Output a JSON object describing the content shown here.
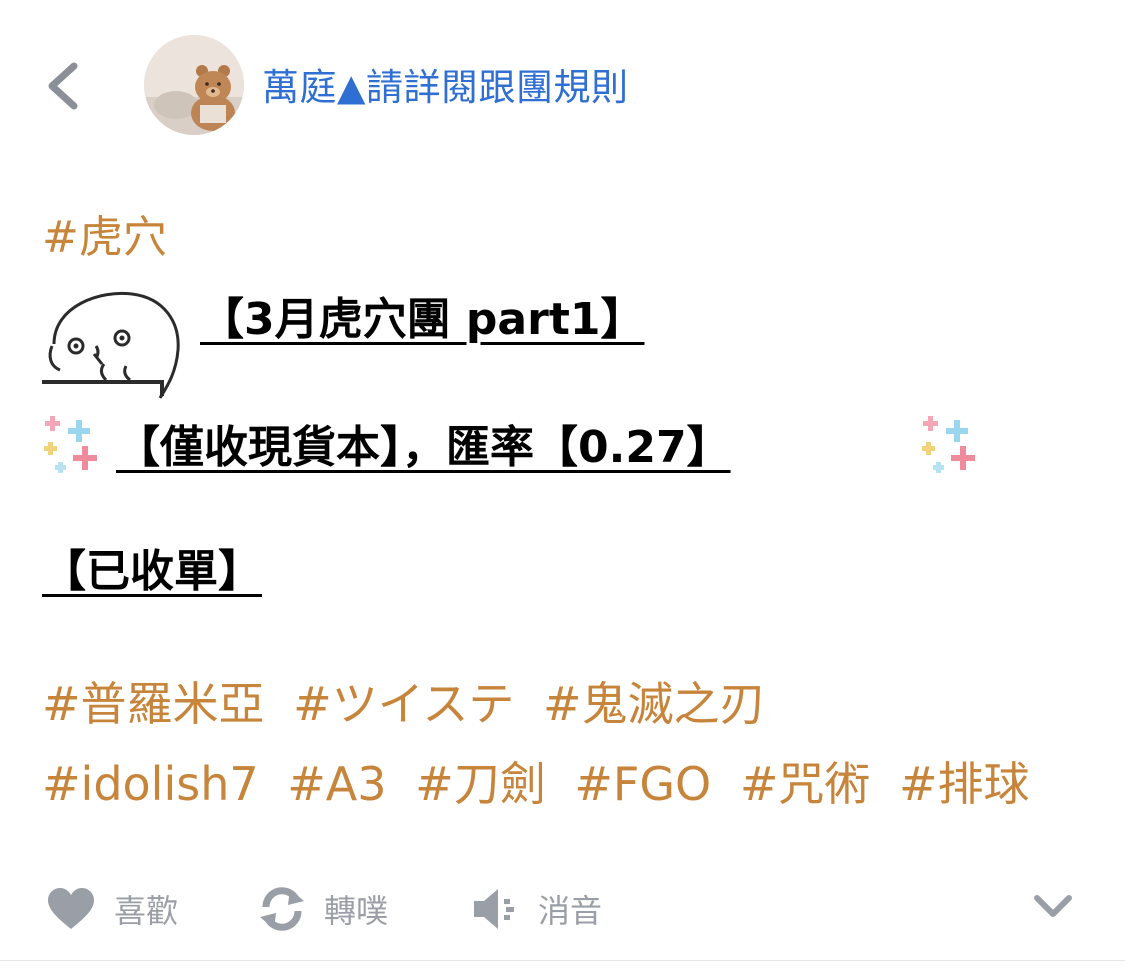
{
  "header": {
    "username": "萬庭▲請詳閱跟團規則",
    "back_icon": "chevron-left-icon",
    "avatar_icon": "teddy-bear-avatar"
  },
  "post": {
    "hashtag_top": "#虎穴",
    "title": "【3月虎穴團 part1】",
    "line2": "【僅收現貨本】，匯率【0.27】",
    "line3": "【已收單】",
    "tags_row1": [
      "#普羅米亞",
      "#ツイステ",
      "#鬼滅之刃"
    ],
    "tags_row2": [
      "#idolish7",
      "#A3",
      "#刀劍",
      "#FGO",
      "#咒術",
      "#排球"
    ]
  },
  "actions": {
    "like": "喜歡",
    "replurk": "轉噗",
    "mute": "消音",
    "more_icon": "chevron-down-icon"
  },
  "colors": {
    "username": "#2f6fd3",
    "tag": "#c7843b",
    "action_gray": "#9a9ea6"
  }
}
